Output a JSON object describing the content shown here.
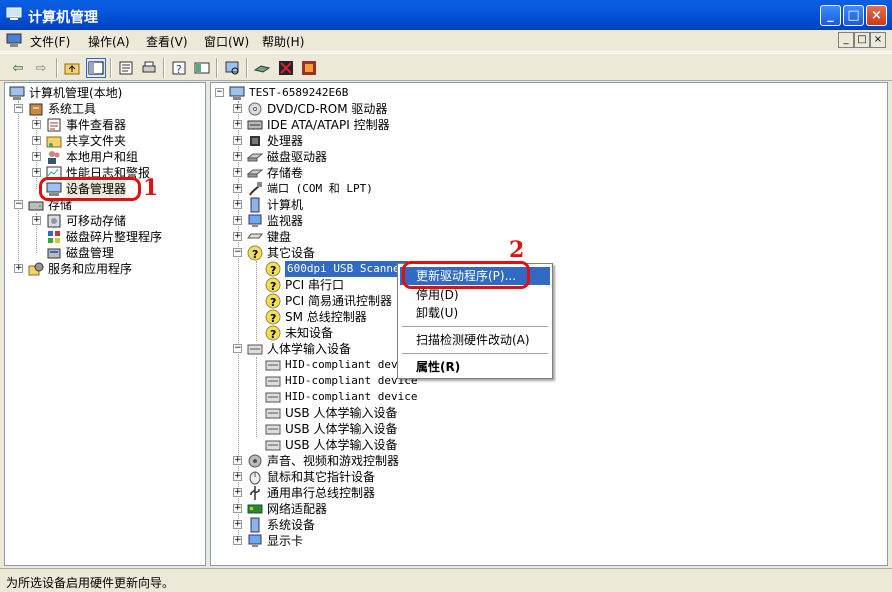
{
  "window": {
    "title": "计算机管理"
  },
  "menubar": {
    "items": [
      "文件(F)",
      "操作(A)",
      "查看(V)",
      "窗口(W)",
      "帮助(H)"
    ],
    "mdi_buttons": [
      "_",
      "□",
      "×"
    ]
  },
  "left_tree": {
    "root": "计算机管理(本地)",
    "system_tools": "系统工具",
    "event_viewer": "事件查看器",
    "shared_folders": "共享文件夹",
    "local_users": "本地用户和组",
    "perf_logs": "性能日志和警报",
    "device_manager": "设备管理器",
    "storage": "存储",
    "removable": "可移动存储",
    "defrag": "磁盘碎片整理程序",
    "disk_mgmt": "磁盘管理",
    "services": "服务和应用程序"
  },
  "right_tree": {
    "root": "TEST-6589242E6B",
    "items": [
      "DVD/CD-ROM 驱动器",
      "IDE ATA/ATAPI 控制器",
      "处理器",
      "磁盘驱动器",
      "存储卷",
      "端口 (COM 和 LPT)",
      "计算机",
      "监视器",
      "键盘",
      "其它设备"
    ],
    "other_devices": [
      "600dpi USB Scanner",
      "PCI 串行口",
      "PCI 简易通讯控制器",
      "SM 总线控制器",
      "未知设备"
    ],
    "hid_group": "人体学输入设备",
    "hid_items": [
      "HID-compliant devi",
      "HID-compliant device",
      "HID-compliant device",
      "USB 人体学输入设备",
      "USB 人体学输入设备",
      "USB 人体学输入设备"
    ],
    "more_items": [
      "声音、视频和游戏控制器",
      "鼠标和其它指针设备",
      "通用串行总线控制器",
      "网络适配器",
      "系统设备",
      "显示卡"
    ]
  },
  "context_menu": {
    "update_driver": "更新驱动程序(P)...",
    "disable": "停用(D)",
    "uninstall": "卸载(U)",
    "scan": "扫描检测硬件改动(A)",
    "properties": "属性(R)"
  },
  "annotations": {
    "step1": "1",
    "step2": "2"
  },
  "statusbar": {
    "text": "为所选设备启用硬件更新向导。"
  },
  "colors": {
    "title_blue": "#0A5FE0",
    "highlight": "#316AC5",
    "annotation_red": "#E01010"
  }
}
